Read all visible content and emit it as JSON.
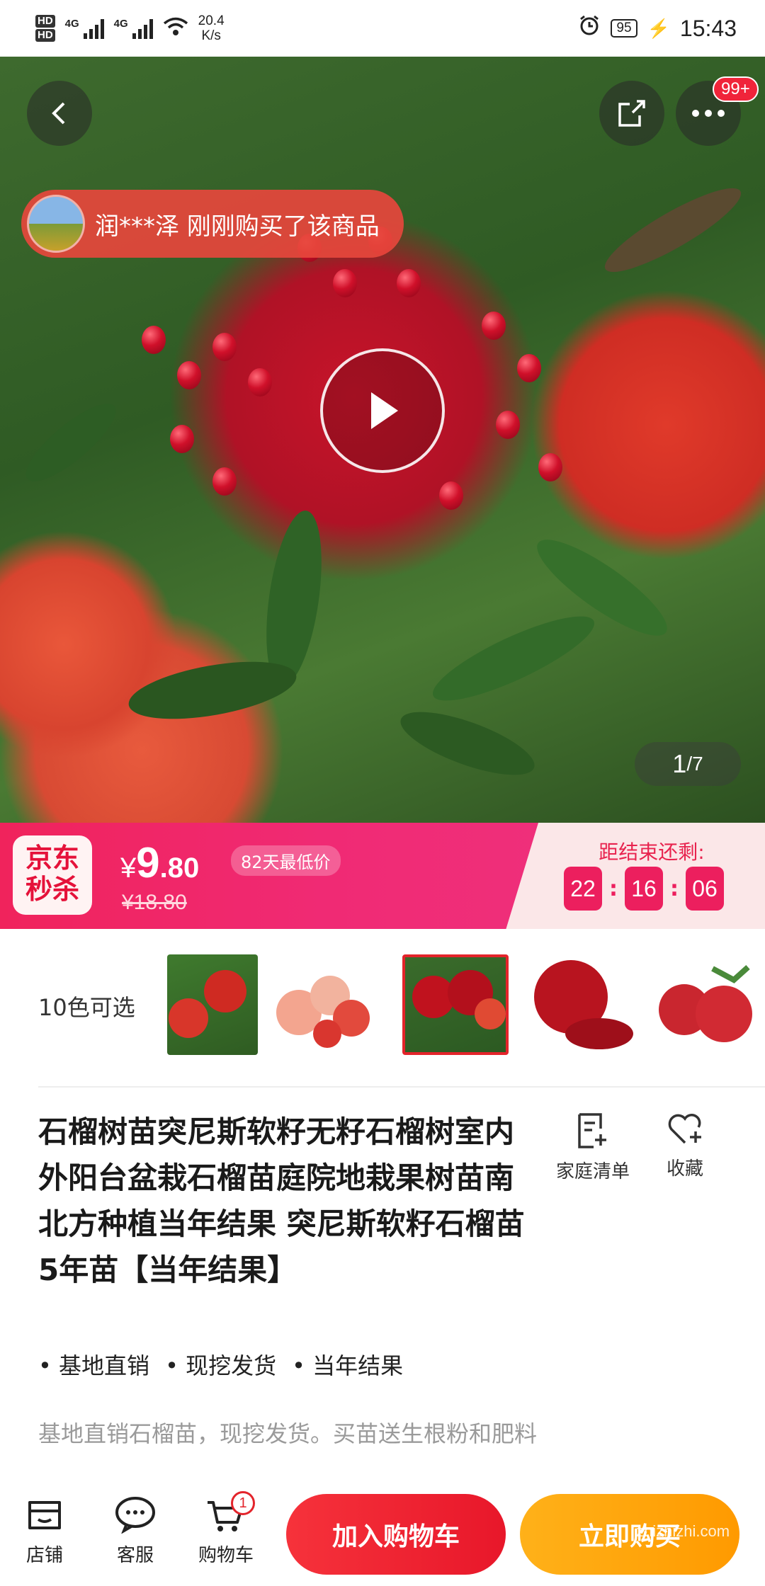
{
  "status_bar": {
    "sim1": "HD",
    "sim2": "HD",
    "net1": "4G",
    "net2": "4G",
    "speed_value": "20.4",
    "speed_unit": "K/s",
    "battery": "95",
    "time": "15:43"
  },
  "hero": {
    "notification_badge": "99+",
    "buyer_notice": "润***泽 刚刚购买了该商品",
    "pager_current": "1",
    "pager_total": "/7"
  },
  "promo": {
    "logo_line1": "京东",
    "logo_line2": "秒杀",
    "currency": "¥",
    "price_int": "9",
    "price_dec": ".80",
    "lowest_badge": "82天最低价",
    "original_price": "¥18.80",
    "countdown_label": "距结束还剩:",
    "countdown": {
      "hours": "22",
      "minutes": "16",
      "seconds": "06"
    }
  },
  "variants": {
    "label": "10色可选",
    "selected_index": 2
  },
  "product": {
    "title": "石榴树苗突尼斯软籽无籽石榴树室内外阳台盆栽石榴苗庭院地栽果树苗南北方种植当年结果 突尼斯软籽石榴苗 5年苗【当年结果】",
    "tags": [
      "基地直销",
      "现挖发货",
      "当年结果"
    ],
    "description": "基地直销石榴苗，现挖发货。买苗送生根粉和肥料"
  },
  "actions": {
    "family_list": "家庭清单",
    "favorite": "收藏"
  },
  "bottom_bar": {
    "store": "店铺",
    "service": "客服",
    "cart": "购物车",
    "cart_count": "1",
    "add_to_cart": "加入购物车",
    "buy_now": "立即购买"
  },
  "watermark": "zhizhizhi.com",
  "colors": {
    "promo_pink": "#f0235c",
    "cart_red": "#e8172a",
    "buy_orange": "#ff9a00",
    "countdown_box": "#ec1f5e"
  }
}
